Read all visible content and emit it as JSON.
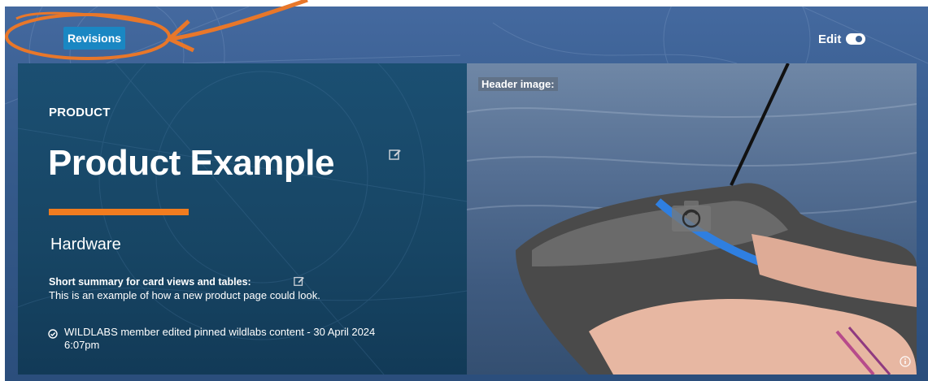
{
  "toolbar": {
    "revisions_label": "Revisions",
    "edit_label": "Edit",
    "edit_enabled": true
  },
  "product": {
    "eyebrow": "PRODUCT",
    "title": "Product Example",
    "category": "Hardware",
    "summary_label": "Short summary for card views and tables:",
    "summary_text": "This is an example of how a new product page could look.",
    "activity_line1": "WILDLABS member edited pinned wildlabs content -  30 April 2024",
    "activity_line2": "6:07pm"
  },
  "header_image": {
    "label": "Header image:"
  },
  "icons": [
    "edit-icon",
    "check-circle-icon",
    "camera-icon",
    "info-icon",
    "toggle-icon"
  ],
  "colors": {
    "accent_orange": "#f07c1f",
    "button_blue": "#1a87c3",
    "panel_navy": "#174564",
    "banner_blue": "#3a5f91",
    "annotation_orange": "#e8772a",
    "tag_blue": "#2f7fe0"
  }
}
